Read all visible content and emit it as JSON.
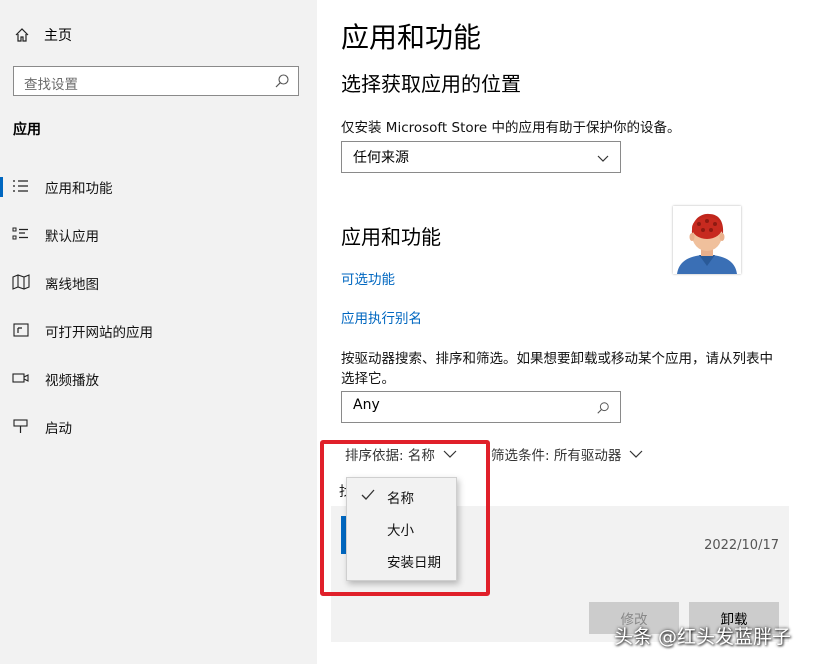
{
  "sidebar": {
    "home_label": "主页",
    "search_placeholder": "查找设置",
    "section_title": "应用",
    "items": [
      {
        "label": "应用和功能",
        "icon": "apps-features-icon",
        "active": true
      },
      {
        "label": "默认应用",
        "icon": "default-apps-icon"
      },
      {
        "label": "离线地图",
        "icon": "offline-maps-icon"
      },
      {
        "label": "可打开网站的应用",
        "icon": "apps-for-websites-icon"
      },
      {
        "label": "视频播放",
        "icon": "video-playback-icon"
      },
      {
        "label": "启动",
        "icon": "startup-icon"
      }
    ]
  },
  "main": {
    "title": "应用和功能",
    "install_section_title": "选择获取应用的位置",
    "install_description": "仅安装 Microsoft Store 中的应用有助于保护你的设备。",
    "install_source_value": "任何来源",
    "apps_section_title": "应用和功能",
    "optional_features_link": "可选功能",
    "app_alias_link": "应用执行别名",
    "search_description_line1": "按驱动器搜索、排序和筛选。如果想要卸载或移动某个应用，请从列表中",
    "search_description_line2": "选择它。",
    "app_search_value": "Any",
    "sort_label": "排序依据: 名称",
    "filter_label": "筛选条件: 所有驱动器",
    "list_peek_char": "找",
    "app_item": {
      "date": "2022/10/17",
      "modify_label": "修改",
      "uninstall_label": "卸载"
    }
  },
  "sort_menu": {
    "options": [
      {
        "label": "名称",
        "checked": true
      },
      {
        "label": "大小",
        "checked": false
      },
      {
        "label": "安装日期",
        "checked": false
      }
    ]
  },
  "colors": {
    "accent": "#0067c0",
    "highlight_border": "#e0202a",
    "sidebar_bg": "#f2f2f2"
  },
  "watermark": "头条 @红头发蓝胖子"
}
